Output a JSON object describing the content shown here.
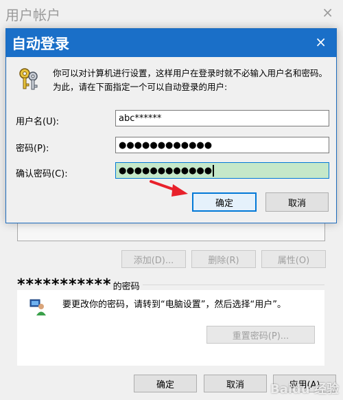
{
  "background_window": {
    "title": "用户帐户",
    "close_glyph": "×",
    "list_buttons": {
      "add": "添加(D)...",
      "remove": "删除(R)",
      "properties": "属性(O)"
    },
    "password_group": {
      "masked_user": "***********",
      "label_suffix": "的密码",
      "message": "要更改你的密码，请转到“电脑设置”，然后选择“用户”。",
      "reset_button": "重置密码(P)..."
    },
    "footer": {
      "ok": "确定",
      "cancel": "取消",
      "apply": "应用(A)"
    }
  },
  "dialog": {
    "title": "自动登录",
    "close_glyph": "×",
    "info_line1": "你可以对计算机进行设置，这样用户在登录时就不必输入用户名和密码。",
    "info_line2": "为此，请在下面指定一个可以自动登录的用户:",
    "fields": {
      "username_label": "用户名(U):",
      "username_value": "abc******",
      "password_label": "密码(P):",
      "password_value": "●●●●●●●●●●●●",
      "confirm_label": "确认密码(C):",
      "confirm_value": "●●●●●●●●●●●●"
    },
    "ok_button": "确定",
    "cancel_button": "取消"
  },
  "watermark": "Baidu 经验",
  "colors": {
    "titlebar": "#1a6fc8",
    "active_field": "#c5e8c9",
    "arrow": "#e8212b"
  }
}
